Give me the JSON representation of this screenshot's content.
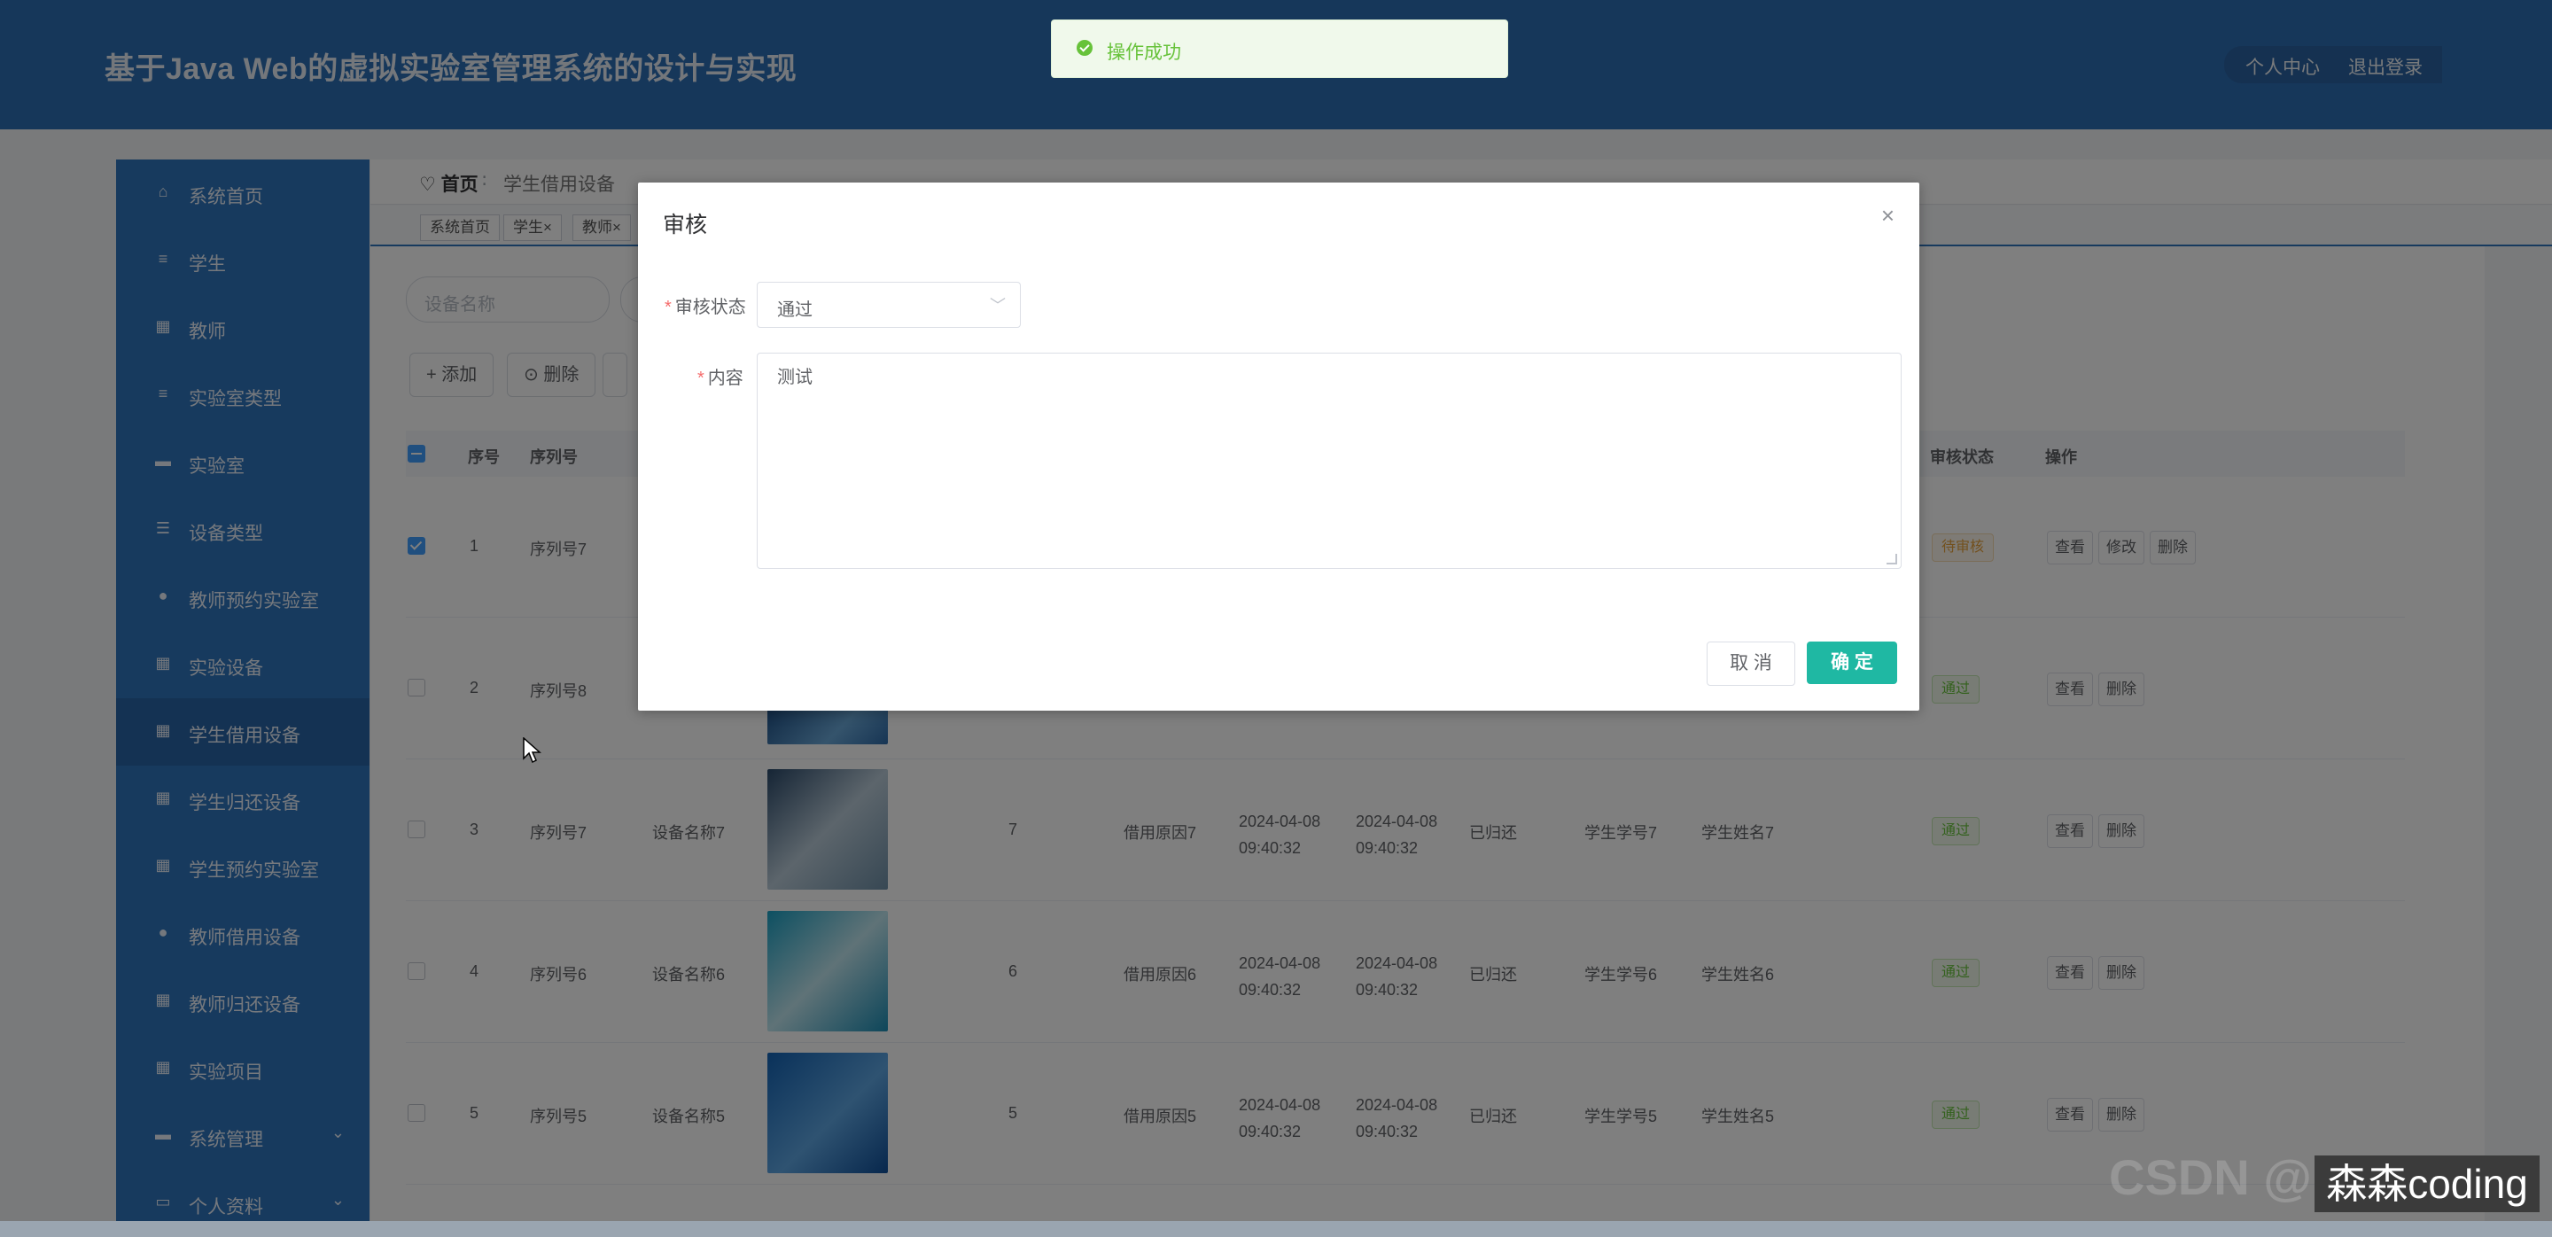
{
  "header": {
    "title": "基于Java Web的虚拟实验室管理系统的设计与实现",
    "user_center": "个人中心",
    "logout": "退出登录"
  },
  "toast": {
    "text": "操作成功",
    "type": "success"
  },
  "sidebar": {
    "items": [
      {
        "label": "系统首页",
        "icon": "home-icon",
        "glyph": "⌂"
      },
      {
        "label": "学生",
        "icon": "list-icon",
        "glyph": "≡"
      },
      {
        "label": "教师",
        "icon": "grid-icon",
        "glyph": "▦"
      },
      {
        "label": "实验室类型",
        "icon": "list-icon",
        "glyph": "≡"
      },
      {
        "label": "实验室",
        "icon": "monitor-icon",
        "glyph": "▬"
      },
      {
        "label": "设备类型",
        "icon": "sliders-icon",
        "glyph": "☰"
      },
      {
        "label": "教师预约实验室",
        "icon": "user-icon",
        "glyph": "●"
      },
      {
        "label": "实验设备",
        "icon": "grid-icon",
        "glyph": "▦"
      },
      {
        "label": "学生借用设备",
        "icon": "grid-icon",
        "glyph": "▦"
      },
      {
        "label": "学生归还设备",
        "icon": "grid-icon",
        "glyph": "▦"
      },
      {
        "label": "学生预约实验室",
        "icon": "grid-icon",
        "glyph": "▦"
      },
      {
        "label": "教师借用设备",
        "icon": "user-icon",
        "glyph": "●"
      },
      {
        "label": "教师归还设备",
        "icon": "grid-icon",
        "glyph": "▦"
      },
      {
        "label": "实验项目",
        "icon": "grid-icon",
        "glyph": "▦"
      },
      {
        "label": "系统管理",
        "icon": "monitor-icon",
        "glyph": "▬"
      },
      {
        "label": "个人资料",
        "icon": "card-icon",
        "glyph": "▭"
      }
    ],
    "active_index": 8
  },
  "breadcrumb": {
    "home": "首页",
    "separator": "∶",
    "current": "学生借用设备"
  },
  "tags": [
    "系统首页",
    "学生×",
    "教师×"
  ],
  "search": {
    "placeholder": "设备名称"
  },
  "toolbar": {
    "add_label": "+ 添加",
    "delete_label": "⊙ 删除"
  },
  "table": {
    "headers": {
      "index": "序号",
      "serial": "序列号",
      "audit_status": "审核状态",
      "actions": "操作"
    },
    "rows": [
      {
        "index": "1",
        "serial": "序列号7",
        "name": "",
        "qty": "",
        "reason": "",
        "t1": "",
        "t2": "",
        "status": "",
        "sno": "",
        "sname": "",
        "audit": "待审核",
        "checked": true
      },
      {
        "index": "2",
        "serial": "序列号8",
        "name": "",
        "qty": "",
        "reason": "",
        "t1": "",
        "t2": "",
        "status": "",
        "sno": "",
        "sname": "",
        "audit": "通过",
        "checked": false
      },
      {
        "index": "3",
        "serial": "序列号7",
        "name": "设备名称7",
        "qty": "7",
        "reason": "借用原因7",
        "t1": "2024-04-08 09:40:32",
        "t2": "2024-04-08 09:40:32",
        "status": "已归还",
        "sno": "学生学号7",
        "sname": "学生姓名7",
        "audit": "通过",
        "checked": false
      },
      {
        "index": "4",
        "serial": "序列号6",
        "name": "设备名称6",
        "qty": "6",
        "reason": "借用原因6",
        "t1": "2024-04-08 09:40:32",
        "t2": "2024-04-08 09:40:32",
        "status": "已归还",
        "sno": "学生学号6",
        "sname": "学生姓名6",
        "audit": "通过",
        "checked": false
      },
      {
        "index": "5",
        "serial": "序列号5",
        "name": "设备名称5",
        "qty": "5",
        "reason": "借用原因5",
        "t1": "2024-04-08 09:40:32",
        "t2": "2024-04-08 09:40:32",
        "status": "已归还",
        "sno": "学生学号5",
        "sname": "学生姓名5",
        "audit": "通过",
        "checked": false
      }
    ],
    "op_view": "查看",
    "op_edit": "修改",
    "op_delete": "删除"
  },
  "dialog": {
    "title": "审核",
    "status_label": "审核状态",
    "status_value": "通过",
    "content_label": "内容",
    "content_value": "测试",
    "cancel_label": "取 消",
    "ok_label": "确 定",
    "required_mark": "*",
    "close_glyph": "×"
  },
  "watermark": {
    "text": "森森coding",
    "faint": "CSDN @..."
  },
  "colors": {
    "header": "#2d6fb5",
    "sidebar": "#2e74bc",
    "primary": "#1fb8a3",
    "success": "#67c23a",
    "warning": "#e6a23c"
  }
}
